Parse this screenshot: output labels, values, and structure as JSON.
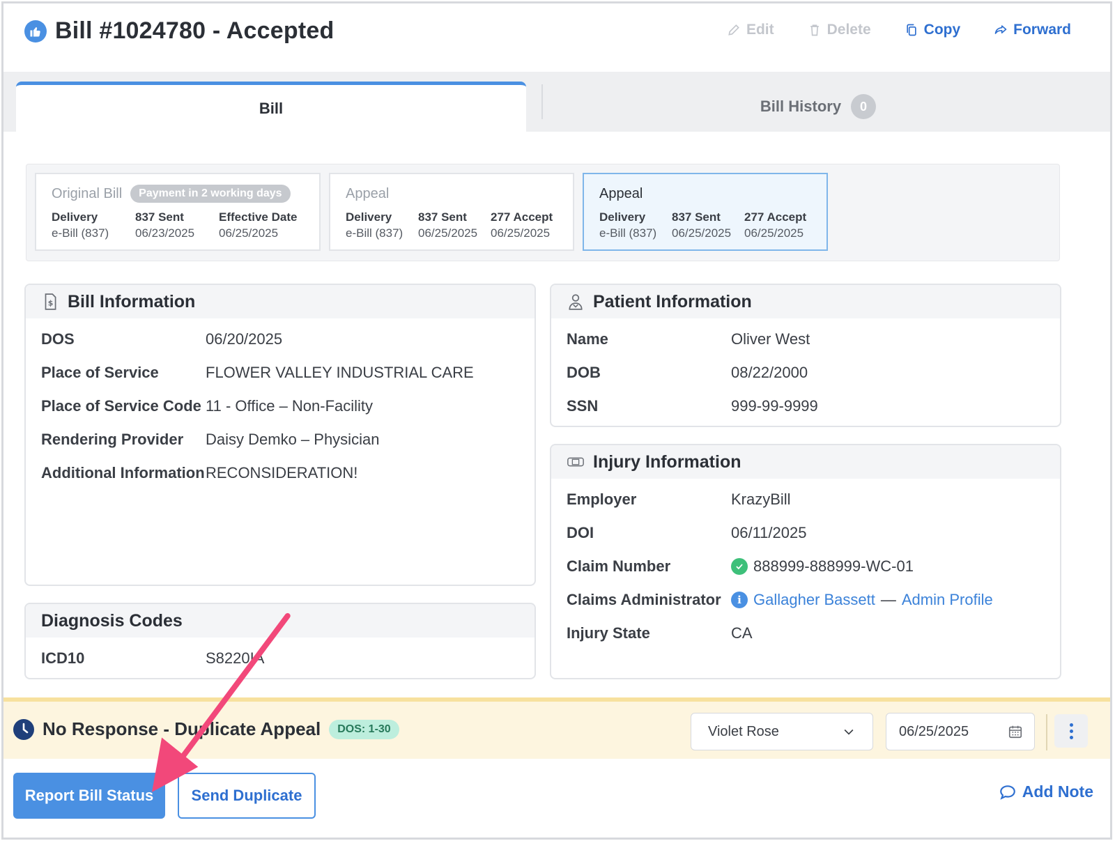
{
  "header": {
    "title": "Bill #1024780 - Accepted",
    "actions": {
      "edit": "Edit",
      "delete": "Delete",
      "copy": "Copy",
      "forward": "Forward"
    }
  },
  "tabs": {
    "bill": "Bill",
    "history": "Bill History",
    "history_count": "0"
  },
  "versions": [
    {
      "title": "Original Bill",
      "badge": "Payment in 2 working days",
      "cols": [
        {
          "label": "Delivery",
          "value": "e-Bill (837)"
        },
        {
          "label": "837 Sent",
          "value": "06/23/2025"
        },
        {
          "label": "Effective Date",
          "value": "06/25/2025"
        }
      ]
    },
    {
      "title": "Appeal",
      "cols": [
        {
          "label": "Delivery",
          "value": "e-Bill (837)"
        },
        {
          "label": "837 Sent",
          "value": "06/25/2025"
        },
        {
          "label": "277 Accept",
          "value": "06/25/2025"
        }
      ]
    },
    {
      "title": "Appeal",
      "cols": [
        {
          "label": "Delivery",
          "value": "e-Bill (837)"
        },
        {
          "label": "837 Sent",
          "value": "06/25/2025"
        },
        {
          "label": "277 Accept",
          "value": "06/25/2025"
        }
      ]
    }
  ],
  "bill_info": {
    "title": "Bill Information",
    "rows": [
      {
        "label": "DOS",
        "value": "06/20/2025"
      },
      {
        "label": "Place of Service",
        "value": "FLOWER VALLEY INDUSTRIAL CARE"
      },
      {
        "label": "Place of Service Code",
        "value": "11 - Office – Non-Facility"
      },
      {
        "label": "Rendering Provider",
        "value": "Daisy Demko – Physician"
      },
      {
        "label": "Additional Information",
        "value": "RECONSIDERATION!"
      }
    ]
  },
  "diagnosis": {
    "title": "Diagnosis Codes",
    "rows": [
      {
        "label": "ICD10",
        "value": "S8220IA"
      }
    ]
  },
  "patient_info": {
    "title": "Patient Information",
    "rows": [
      {
        "label": "Name",
        "value": "Oliver West"
      },
      {
        "label": "DOB",
        "value": "08/22/2000"
      },
      {
        "label": "SSN",
        "value": "999-99-9999"
      }
    ]
  },
  "injury_info": {
    "title": "Injury Information",
    "employer_label": "Employer",
    "employer": "KrazyBill",
    "doi_label": "DOI",
    "doi": "06/11/2025",
    "claim_label": "Claim Number",
    "claim": "888999-888999-WC-01",
    "admin_label": "Claims Administrator",
    "admin_name": "Gallagher Bassett",
    "admin_sep": "—",
    "admin_profile": "Admin Profile",
    "state_label": "Injury State",
    "state": "CA"
  },
  "status": {
    "text": "No Response - Duplicate Appeal",
    "badge": "DOS: 1-30",
    "assignee": "Violet Rose",
    "date": "06/25/2025"
  },
  "footer": {
    "report": "Report Bill Status",
    "duplicate": "Send Duplicate",
    "add_note": "Add Note"
  },
  "colors": {
    "accent": "#4a90e2",
    "link": "#2e6fd0",
    "status_bg": "#fdf5df",
    "annotation_arrow": "#f2487a"
  }
}
